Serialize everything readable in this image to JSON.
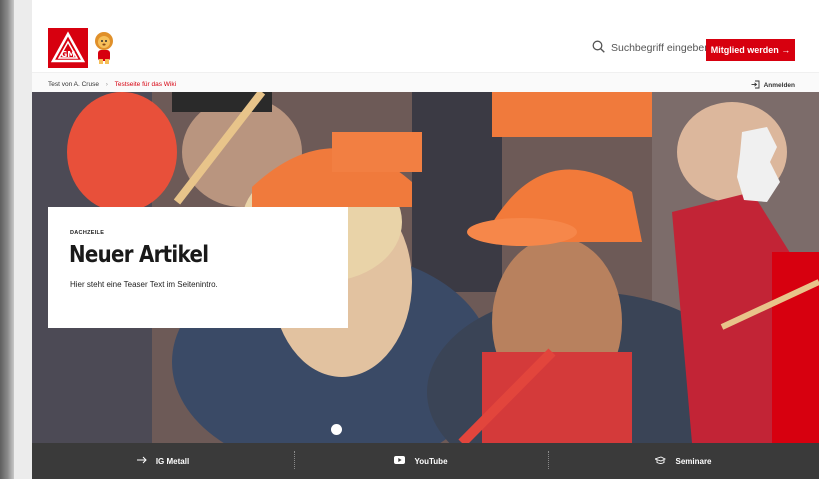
{
  "header": {
    "search_label": "Suchbegriff eingeben",
    "cta_label": "Mitglied werden →",
    "logo_icon": "igm-logo-icon",
    "mascot_icon": "lion-mascot-icon",
    "search_icon": "search-icon"
  },
  "breadcrumb": {
    "items": [
      "Test von A. Cruse",
      "Testseite für das Wiki"
    ],
    "separator": "›"
  },
  "login": {
    "label": "Anmelden",
    "icon": "login-icon"
  },
  "hero": {
    "kicker": "DACHZEILE",
    "title": "Neuer Artikel",
    "intro": "Hier steht eine Teaser Text im Seitenintro."
  },
  "footer": {
    "items": [
      {
        "label": "IG Metall",
        "icon": "arrow-right-icon"
      },
      {
        "label": "YouTube",
        "icon": "youtube-icon"
      },
      {
        "label": "Seminare",
        "icon": "seminar-icon"
      }
    ]
  },
  "colors": {
    "brand_red": "#d7000f",
    "footer_bg": "#3a3a3a"
  }
}
